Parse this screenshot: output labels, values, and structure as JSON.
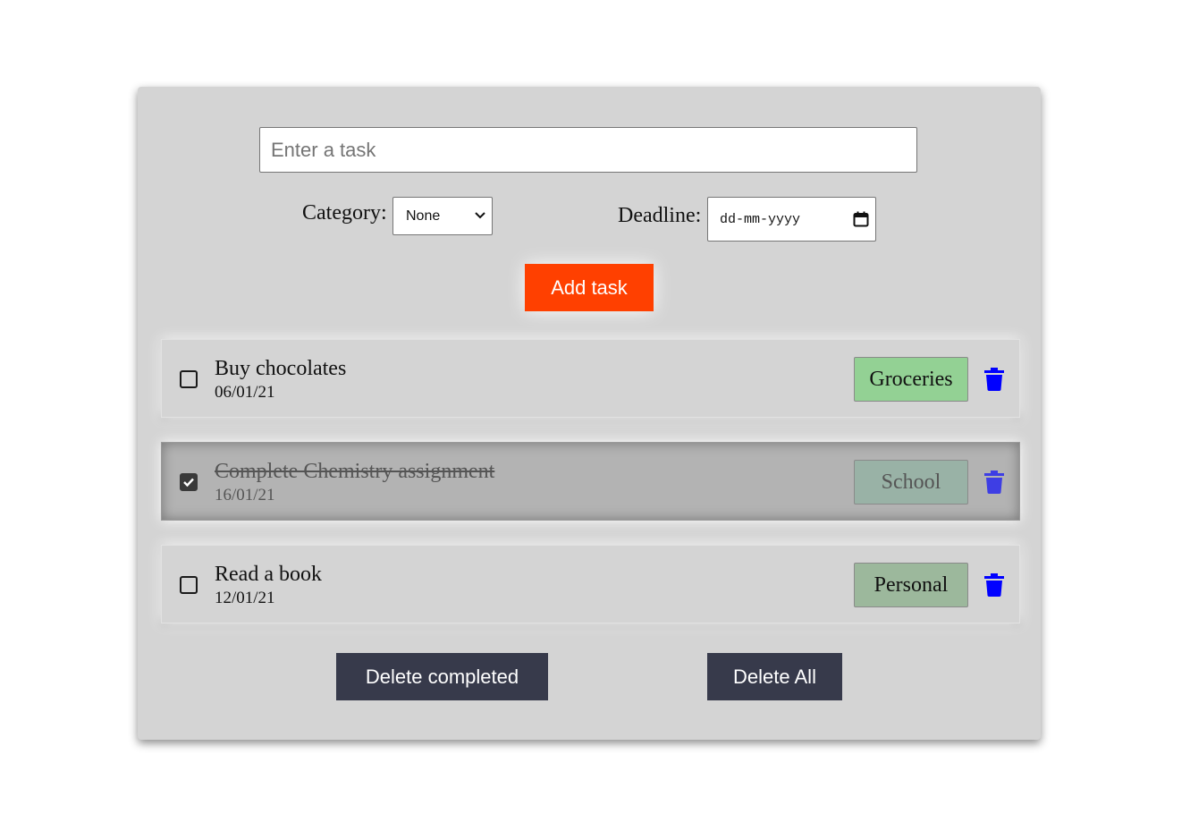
{
  "form": {
    "task_placeholder": "Enter a task",
    "category_label": "Category:",
    "category_selected": "None",
    "deadline_label": "Deadline:",
    "deadline_placeholder": "dd-mm-yyyy",
    "add_button": "Add task"
  },
  "tasks": [
    {
      "title": "Buy chocolates",
      "date": "06/01/21",
      "category": "Groceries",
      "completed": false,
      "badge_color": "#93d194"
    },
    {
      "title": "Complete Chemistry assignment",
      "date": "16/01/21",
      "category": "School",
      "completed": true,
      "badge_color": "#99b2a6"
    },
    {
      "title": "Read a book",
      "date": "12/01/21",
      "category": "Personal",
      "completed": false,
      "badge_color": "#9cb89c"
    }
  ],
  "actions": {
    "delete_completed": "Delete completed",
    "delete_all": "Delete All"
  },
  "colors": {
    "accent": "#ff4000",
    "dark_button": "#373a4b",
    "trash_icon": "#0000ff",
    "card_bg": "#d4d4d4"
  },
  "icons": {
    "checkbox_checked": "check-icon",
    "delete": "trash-icon",
    "dropdown": "chevron-down-icon",
    "date_picker": "calendar-icon"
  }
}
